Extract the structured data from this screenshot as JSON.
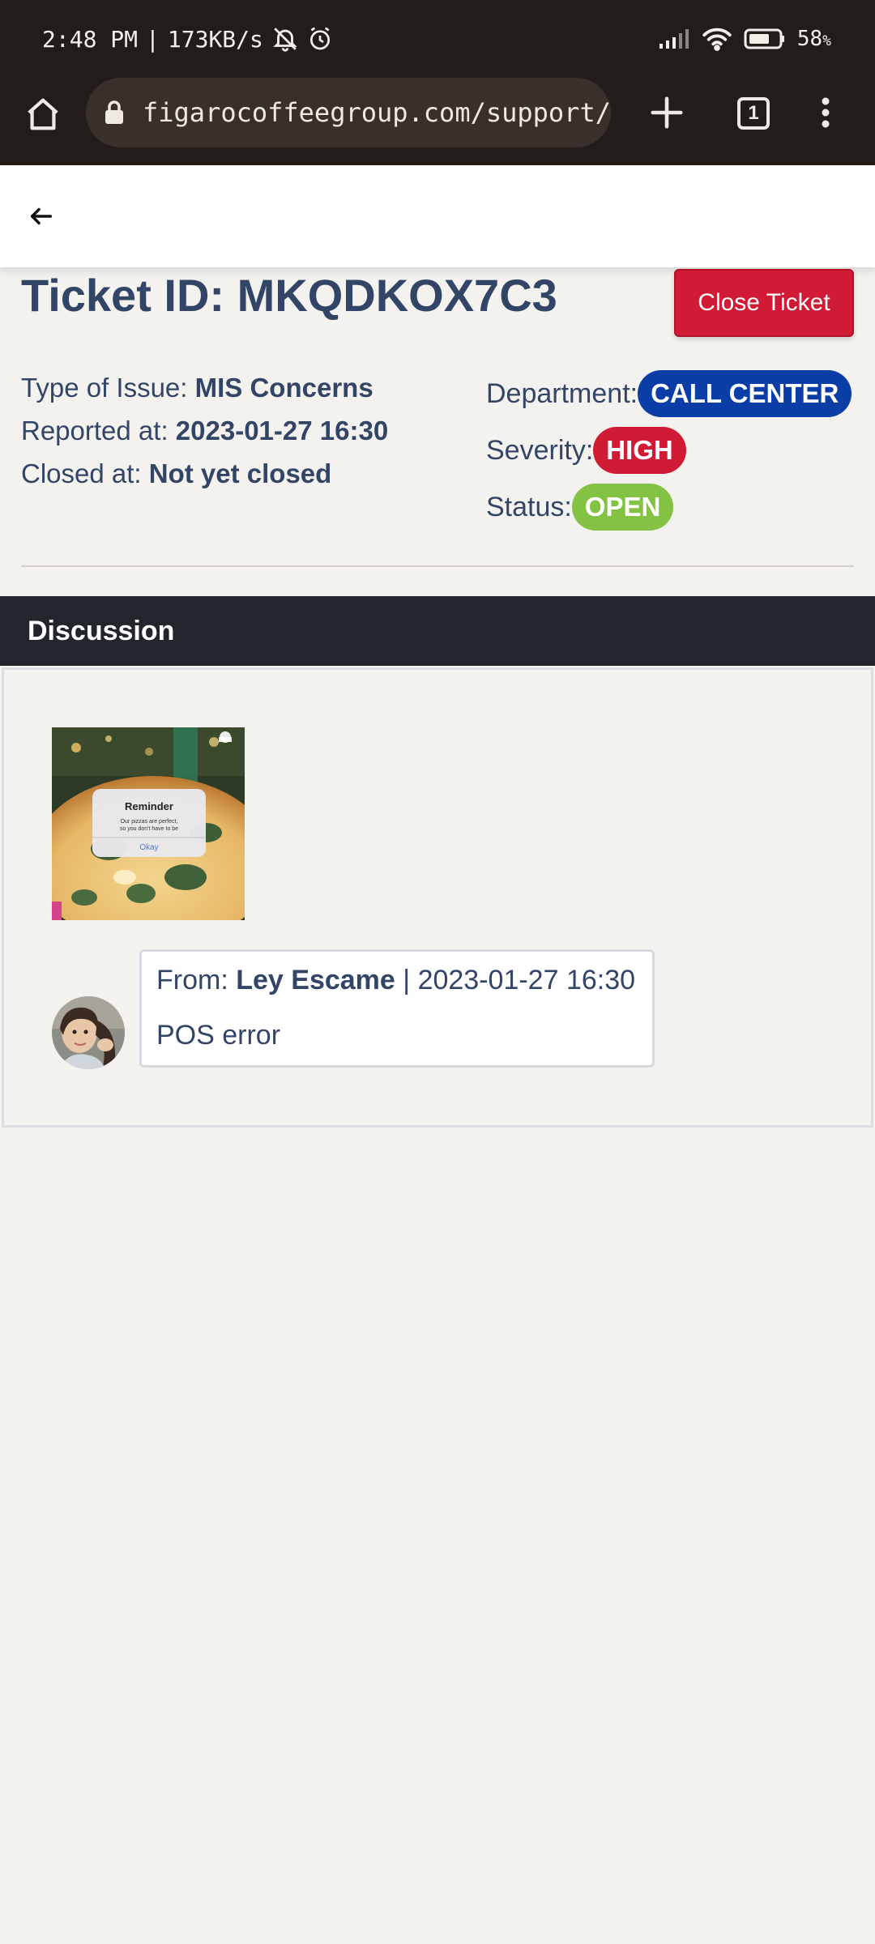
{
  "status_bar": {
    "time": "2:48 PM",
    "separator": "|",
    "speed": "173KB/s",
    "battery": "58",
    "battery_unit": "%"
  },
  "browser": {
    "url": "figarocoffeegroup.com/support/",
    "tab_count": "1"
  },
  "ticket": {
    "id_label": "Ticket ID:",
    "id_value": "MKQDKOX7C3",
    "close_label": "Close Ticket",
    "type_label": "Type of Issue:",
    "type_value": "MIS Concerns",
    "reported_label": "Reported at:",
    "reported_value": "2023-01-27 16:30",
    "closed_label": "Closed at:",
    "closed_value": "Not yet closed",
    "department_label": "Department:",
    "department_value": "CALL CENTER",
    "severity_label": "Severity:",
    "severity_value": "HIGH",
    "status_label": "Status:",
    "status_value": "OPEN"
  },
  "colors": {
    "department_badge": "#0a3da6",
    "severity_badge": "#d11a33",
    "status_badge": "#84c244",
    "close_button": "#d11a33",
    "text": "#334566"
  },
  "discussion": {
    "title": "Discussion",
    "attachment": {
      "dialog_title": "Reminder",
      "dialog_text_line1": "Our pizzas are perfect,",
      "dialog_text_line2": "so you don't have to be",
      "dialog_button": "Okay"
    },
    "message": {
      "from_label": "From:",
      "author": "Ley Escame",
      "separator": "|",
      "timestamp": "2023-01-27 16:30",
      "text": "POS error"
    }
  }
}
